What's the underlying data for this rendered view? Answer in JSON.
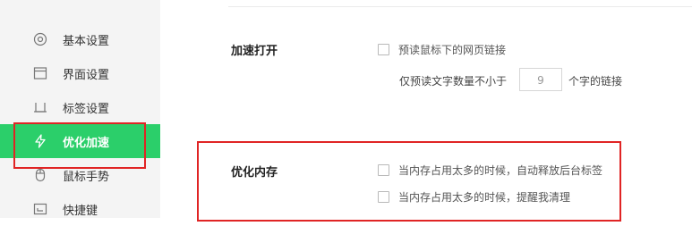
{
  "sidebar": {
    "items": [
      {
        "label": "基本设置",
        "icon": "gear-circle-icon"
      },
      {
        "label": "界面设置",
        "icon": "window-icon"
      },
      {
        "label": "标签设置",
        "icon": "tab-icon"
      },
      {
        "label": "优化加速",
        "icon": "lightning-icon",
        "active": true
      },
      {
        "label": "鼠标手势",
        "icon": "mouse-icon"
      },
      {
        "label": "快捷键",
        "icon": "keyboard-icon"
      }
    ]
  },
  "sections": {
    "speed_open": {
      "title": "加速打开",
      "preload_option": "预读鼠标下的网页链接",
      "min_chars_prefix": "仅预读文字数量不小于",
      "min_chars_value": "9",
      "min_chars_suffix": "个字的链接"
    },
    "optimize_memory": {
      "title": "优化内存",
      "option_auto_release": "当内存占用太多的时候，自动释放后台标签",
      "option_remind": "当内存占用太多的时候，提醒我清理"
    }
  },
  "colors": {
    "active_bg": "#2bcf6a",
    "highlight_border": "#e02424",
    "sidebar_bg": "#f4f4f4"
  }
}
